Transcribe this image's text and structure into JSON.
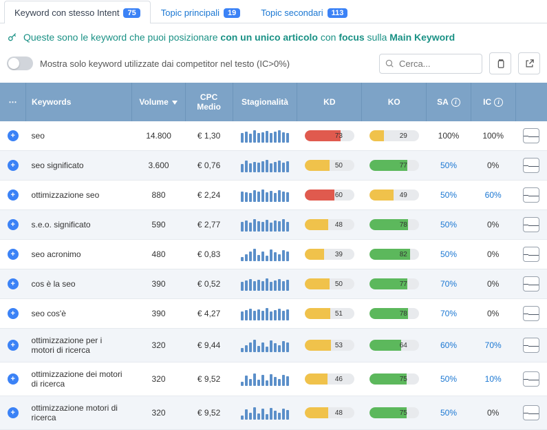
{
  "tabs": [
    {
      "label": "Keyword con stesso Intent",
      "badge": "75",
      "active": true
    },
    {
      "label": "Topic principali",
      "badge": "19",
      "active": false
    },
    {
      "label": "Topic secondari",
      "badge": "113",
      "active": false
    }
  ],
  "info_parts": {
    "a": "Queste sono le keyword che puoi posizionare ",
    "b": "con un unico articolo",
    "c": " con ",
    "d": "focus",
    "e": " sulla ",
    "f": "Main Keyword"
  },
  "filter": {
    "toggle_label": "Mostra solo keyword utilizzate dai competitor nel testo (IC>0%)"
  },
  "search": {
    "placeholder": "Cerca..."
  },
  "columns": {
    "expand": "⋯",
    "keywords": "Keywords",
    "volume": "Volume",
    "cpc": "CPC Medio",
    "season": "Stagionalità",
    "kd": "KD",
    "ko": "KO",
    "sa": "SA",
    "ic": "IC"
  },
  "rows": [
    {
      "keyword": "seo",
      "volume": "14.800",
      "cpc": "€ 1,30",
      "spark": [
        14,
        16,
        13,
        18,
        14,
        15,
        17,
        14,
        16,
        18,
        15,
        14
      ],
      "kd": 73,
      "kd_color": "#e05a4e",
      "ko": 29,
      "ko_color": "#f0c24b",
      "sa": "100%",
      "sa_link": false,
      "ic": "100%",
      "ic_link": false
    },
    {
      "keyword": "seo significato",
      "volume": "3.600",
      "cpc": "€ 0,76",
      "spark": [
        12,
        17,
        13,
        15,
        14,
        16,
        18,
        13,
        15,
        17,
        14,
        16
      ],
      "kd": 50,
      "kd_color": "#f0c24b",
      "ko": 77,
      "ko_color": "#5cb85c",
      "sa": "50%",
      "sa_link": true,
      "ic": "0%",
      "ic_link": false
    },
    {
      "keyword": "ottimizzazione seo",
      "volume": "880",
      "cpc": "€ 2,24",
      "spark": [
        15,
        14,
        13,
        17,
        15,
        18,
        14,
        16,
        13,
        17,
        15,
        14
      ],
      "kd": 60,
      "kd_color": "#e05a4e",
      "ko": 49,
      "ko_color": "#f0c24b",
      "sa": "50%",
      "sa_link": true,
      "ic": "60%",
      "ic_link": true
    },
    {
      "keyword": "s.e.o. significato",
      "volume": "590",
      "cpc": "€ 2,77",
      "spark": [
        14,
        16,
        13,
        18,
        15,
        14,
        17,
        13,
        16,
        15,
        18,
        14
      ],
      "kd": 48,
      "kd_color": "#f0c24b",
      "ko": 78,
      "ko_color": "#5cb85c",
      "sa": "50%",
      "sa_link": true,
      "ic": "0%",
      "ic_link": false
    },
    {
      "keyword": "seo acronimo",
      "volume": "480",
      "cpc": "€ 0,83",
      "spark": [
        6,
        10,
        14,
        18,
        9,
        14,
        8,
        17,
        13,
        10,
        16,
        14
      ],
      "kd": 39,
      "kd_color": "#f0c24b",
      "ko": 82,
      "ko_color": "#5cb85c",
      "sa": "50%",
      "sa_link": true,
      "ic": "0%",
      "ic_link": false
    },
    {
      "keyword": "cos è la seo",
      "volume": "390",
      "cpc": "€ 0,52",
      "spark": [
        13,
        15,
        17,
        14,
        16,
        14,
        18,
        13,
        15,
        17,
        14,
        16
      ],
      "kd": 50,
      "kd_color": "#f0c24b",
      "ko": 77,
      "ko_color": "#5cb85c",
      "sa": "70%",
      "sa_link": true,
      "ic": "0%",
      "ic_link": false
    },
    {
      "keyword": "seo cos'è",
      "volume": "390",
      "cpc": "€ 4,27",
      "spark": [
        13,
        15,
        17,
        14,
        16,
        14,
        18,
        13,
        15,
        17,
        14,
        16
      ],
      "kd": 51,
      "kd_color": "#f0c24b",
      "ko": 78,
      "ko_color": "#5cb85c",
      "sa": "70%",
      "sa_link": true,
      "ic": "0%",
      "ic_link": false
    },
    {
      "keyword": "ottimizzazione per i motori di ricerca",
      "volume": "320",
      "cpc": "€ 9,44",
      "spark": [
        6,
        10,
        14,
        18,
        9,
        14,
        8,
        17,
        13,
        10,
        16,
        14
      ],
      "kd": 53,
      "kd_color": "#f0c24b",
      "ko": 64,
      "ko_color": "#5cb85c",
      "sa": "60%",
      "sa_link": true,
      "ic": "70%",
      "ic_link": true
    },
    {
      "keyword": "ottimizzazione dei motori di ricerca",
      "volume": "320",
      "cpc": "€ 9,52",
      "spark": [
        6,
        15,
        10,
        18,
        9,
        16,
        8,
        17,
        13,
        10,
        16,
        14
      ],
      "kd": 46,
      "kd_color": "#f0c24b",
      "ko": 75,
      "ko_color": "#5cb85c",
      "sa": "50%",
      "sa_link": true,
      "ic": "10%",
      "ic_link": true
    },
    {
      "keyword": "ottimizzazione motori di ricerca",
      "volume": "320",
      "cpc": "€ 9,52",
      "spark": [
        6,
        15,
        10,
        18,
        9,
        16,
        8,
        17,
        13,
        10,
        16,
        14
      ],
      "kd": 48,
      "kd_color": "#f0c24b",
      "ko": 75,
      "ko_color": "#5cb85c",
      "sa": "50%",
      "sa_link": true,
      "ic": "0%",
      "ic_link": false
    }
  ]
}
